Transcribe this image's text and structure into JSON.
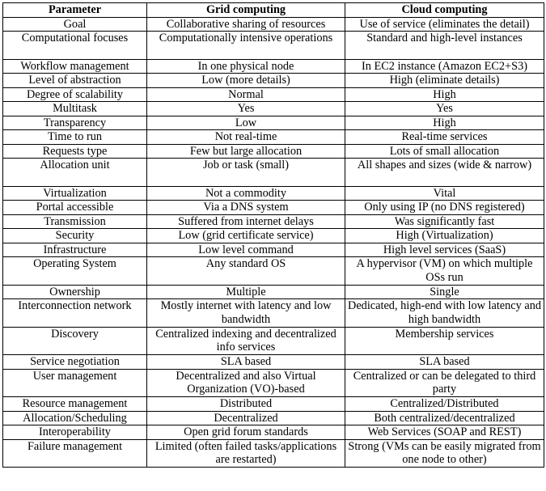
{
  "table": {
    "headers": [
      "Parameter",
      "Grid computing",
      "Cloud computing"
    ],
    "rows": [
      {
        "parameter": "Goal",
        "grid": "Collaborative sharing of resources",
        "cloud": "Use of service (eliminates the detail)",
        "double": false
      },
      {
        "parameter": "Computational focuses",
        "grid": "Computationally intensive operations",
        "cloud": "Standard and high-level instances",
        "double": true
      },
      {
        "parameter": "Workflow management",
        "grid": "In one physical node",
        "cloud": "In EC2 instance (Amazon EC2+S3)",
        "double": false
      },
      {
        "parameter": "Level of abstraction",
        "grid": "Low (more details)",
        "cloud": "High (eliminate details)",
        "double": false
      },
      {
        "parameter": "Degree of scalability",
        "grid": "Normal",
        "cloud": "High",
        "double": false
      },
      {
        "parameter": "Multitask",
        "grid": "Yes",
        "cloud": "Yes",
        "double": false
      },
      {
        "parameter": "Transparency",
        "grid": "Low",
        "cloud": "High",
        "double": false
      },
      {
        "parameter": "Time to run",
        "grid": "Not real-time",
        "cloud": "Real-time services",
        "double": false
      },
      {
        "parameter": "Requests type",
        "grid": "Few but large allocation",
        "cloud": "Lots of small allocation",
        "double": false
      },
      {
        "parameter": "Allocation unit",
        "grid": "Job or task (small)",
        "cloud": "All shapes and sizes (wide & narrow)",
        "double": true
      },
      {
        "parameter": "Virtualization",
        "grid": "Not a commodity",
        "cloud": "Vital",
        "double": false
      },
      {
        "parameter": "Portal accessible",
        "grid": "Via a DNS system",
        "cloud": "Only using IP (no DNS registered)",
        "double": false
      },
      {
        "parameter": "Transmission",
        "grid": "Suffered from internet delays",
        "cloud": "Was significantly fast",
        "double": false
      },
      {
        "parameter": "Security",
        "grid": "Low (grid certificate service)",
        "cloud": "High (Virtualization)",
        "double": false
      },
      {
        "parameter": "Infrastructure",
        "grid": "Low level command",
        "cloud": "High level services (SaaS)",
        "double": false
      },
      {
        "parameter": "Operating System",
        "grid": "Any standard OS",
        "cloud": "A hypervisor (VM) on which multiple OSs run",
        "double": true
      },
      {
        "parameter": "Ownership",
        "grid": "Multiple",
        "cloud": "Single",
        "double": false
      },
      {
        "parameter": "Interconnection network",
        "grid": "Mostly internet with latency and low bandwidth",
        "cloud": "Dedicated, high-end with low latency and high bandwidth",
        "double": true
      },
      {
        "parameter": "Discovery",
        "grid": "Centralized indexing and decentralized info services",
        "cloud": "Membership services",
        "double": true
      },
      {
        "parameter": "Service negotiation",
        "grid": "SLA based",
        "cloud": "SLA based",
        "double": false
      },
      {
        "parameter": "User management",
        "grid": "Decentralized and also Virtual Organization (VO)-based",
        "cloud": "Centralized or can be delegated to third party",
        "double": true
      },
      {
        "parameter": "Resource management",
        "grid": "Distributed",
        "cloud": "Centralized/Distributed",
        "double": false
      },
      {
        "parameter": "Allocation/Scheduling",
        "grid": "Decentralized",
        "cloud": "Both centralized/decentralized",
        "double": false
      },
      {
        "parameter": "Interoperability",
        "grid": "Open grid forum standards",
        "cloud": "Web Services (SOAP and REST)",
        "double": false
      },
      {
        "parameter": "Failure management",
        "grid": "Limited (often failed tasks/applications are restarted)",
        "cloud": "Strong (VMs can be easily migrated from one node to other)",
        "double": true
      }
    ]
  }
}
